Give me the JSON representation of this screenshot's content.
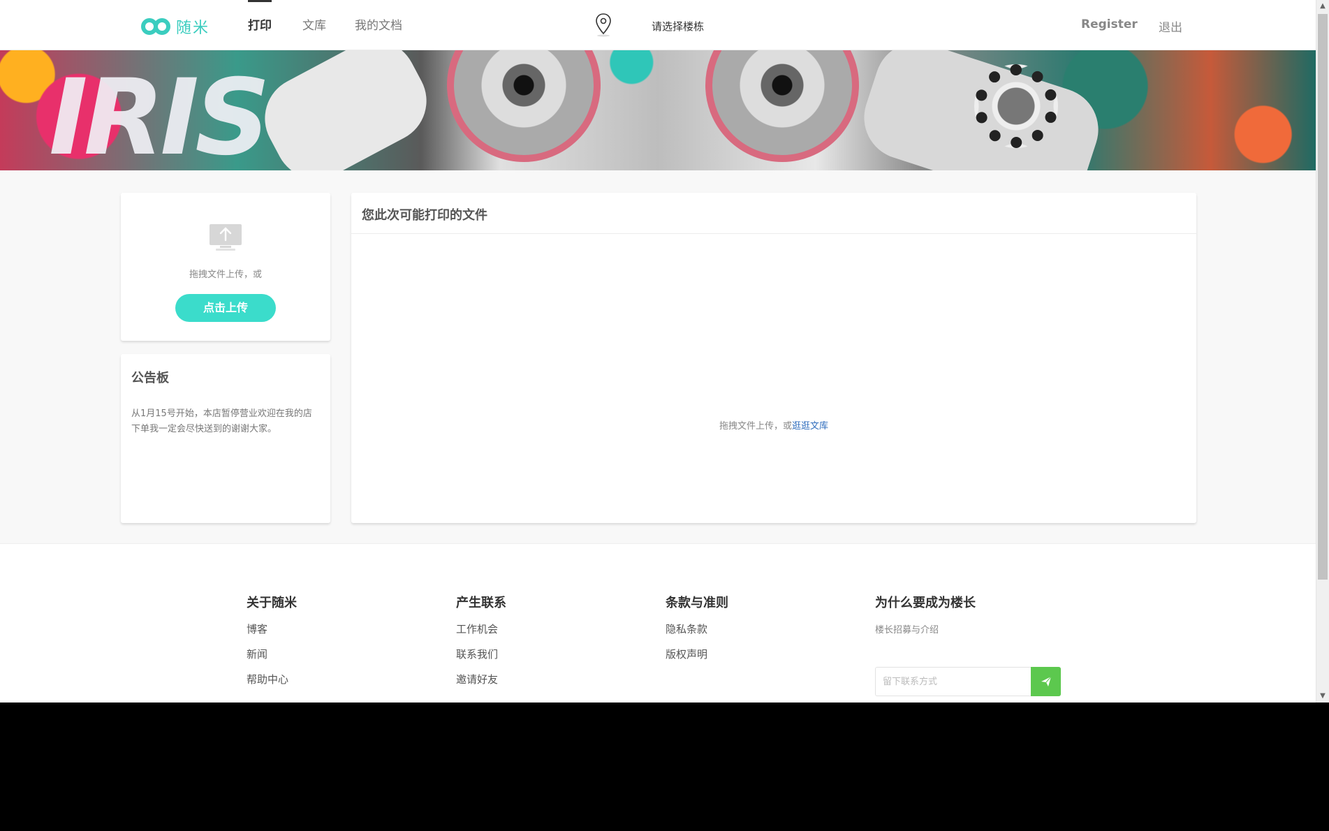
{
  "header": {
    "logo_text": "随米",
    "nav": [
      {
        "label": "打印",
        "active": true
      },
      {
        "label": "文库",
        "active": false
      },
      {
        "label": "我的文档",
        "active": false
      }
    ],
    "location_placeholder": "请选择楼栋",
    "register_label": "Register",
    "logout_label": "退出",
    "accent_color": "#3bcdbf"
  },
  "banner": {
    "title": "IRIS"
  },
  "upload": {
    "hint": "拖拽文件上传，或",
    "button_label": "点击上传",
    "button_color": "#3bdccb",
    "icon": "upload-monitor-icon"
  },
  "bulletin": {
    "title": "公告板",
    "text": "从1月15号开始，本店暂停营业欢迎在我的店下单我一定会尽快送到的谢谢大家。"
  },
  "files": {
    "title": "您此次可能打印的文件",
    "empty_text": "拖拽文件上传，或",
    "empty_link": "逛逛文库",
    "link_color": "#2f6dbd"
  },
  "footer": {
    "columns": [
      {
        "title": "关于随米",
        "links": [
          "博客",
          "新闻",
          "帮助中心"
        ]
      },
      {
        "title": "产生联系",
        "links": [
          "工作机会",
          "联系我们",
          "邀请好友"
        ]
      },
      {
        "title": "条款与准则",
        "links": [
          "隐私条款",
          "版权声明"
        ]
      },
      {
        "title": "为什么要成为楼长",
        "sub": "楼长招募与介绍"
      }
    ],
    "contact_placeholder": "留下联系方式",
    "send_icon": "paper-plane-icon",
    "send_color": "#5cc84e"
  }
}
